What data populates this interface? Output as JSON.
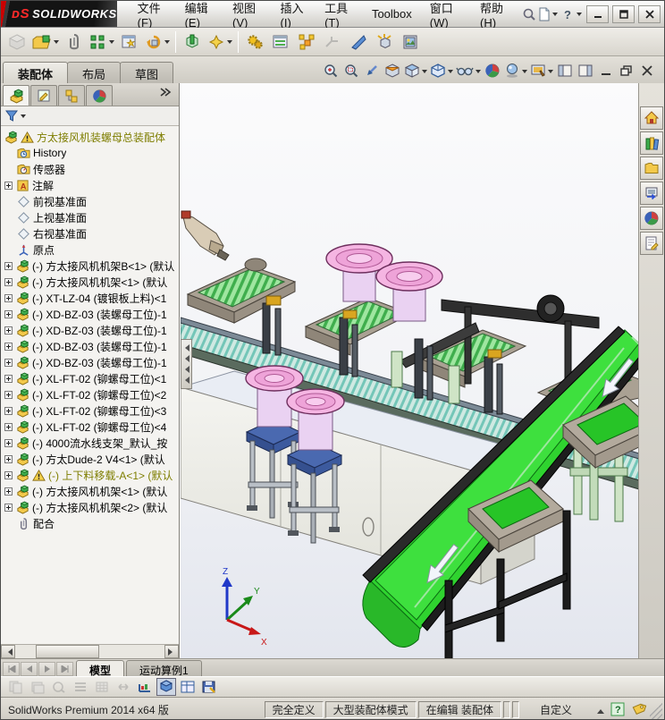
{
  "titlebar": {
    "logo": "SOLIDWORKS",
    "logo_ds": "ᴅS",
    "menus": [
      "文件(F)",
      "编辑(E)",
      "视图(V)",
      "插入(I)",
      "工具(T)",
      "Toolbox",
      "窗口(W)",
      "帮助(H)"
    ]
  },
  "command_tabs": [
    {
      "label": "装配体",
      "active": true
    },
    {
      "label": "布局",
      "active": false
    },
    {
      "label": "草图",
      "active": false
    }
  ],
  "feature_tree": {
    "root": {
      "label": "方太接风机装螺母总装配体"
    },
    "folders": [
      {
        "label": "History"
      },
      {
        "label": "传感器"
      },
      {
        "label": "注解"
      },
      {
        "label": "前视基准面"
      },
      {
        "label": "上视基准面"
      },
      {
        "label": "右视基准面"
      },
      {
        "label": "原点"
      }
    ],
    "components": [
      {
        "label": "(-) 方太接风机机架B<1> (默认"
      },
      {
        "label": "(-) 方太接风机机架<1> (默认"
      },
      {
        "label": "(-) XT-LZ-04 (镀银板上料)<1"
      },
      {
        "label": "(-) XD-BZ-03 (装螺母工位)-1"
      },
      {
        "label": "(-) XD-BZ-03 (装螺母工位)-1"
      },
      {
        "label": "(-) XD-BZ-03 (装螺母工位)-1"
      },
      {
        "label": "(-) XD-BZ-03 (装螺母工位)-1"
      },
      {
        "label": "(-) XL-FT-02 (铆螺母工位)<1"
      },
      {
        "label": "(-) XL-FT-02 (铆螺母工位)<2"
      },
      {
        "label": "(-) XL-FT-02 (铆螺母工位)<3"
      },
      {
        "label": "(-) XL-FT-02 (铆螺母工位)<4"
      },
      {
        "label": "(-) 4000流水线支架_默认_按"
      },
      {
        "label": "(-) 方太Dude-2 V4<1> (默认"
      },
      {
        "label": "(-) 上下料移载-A<1> (默认",
        "warning": true
      },
      {
        "label": "(-) 方太接风机机架<1> (默认"
      },
      {
        "label": "(-) 方太接风机机架<2> (默认"
      }
    ],
    "mates_label": "配合"
  },
  "motion_bar": {
    "tabs": [
      {
        "label": "模型",
        "active": true
      },
      {
        "label": "运动算例1",
        "active": false
      }
    ]
  },
  "statusbar": {
    "left_text": "SolidWorks Premium 2014 x64 版",
    "define_state": "完全定义",
    "assembly_mode": "大型装配体模式",
    "edit_state": "在编辑 装配体",
    "custom_label": "自定义"
  },
  "viewport": {
    "triad": {
      "x": "X",
      "y": "Y",
      "z": "Z"
    }
  },
  "colors": {
    "brand_red": "#d40000",
    "belt_green": "#2fd32f",
    "slat_green": "#3fae4d",
    "bowl_pink": "#f5b5e2",
    "plate_blue": "#4a69b0",
    "warning_olive": "#7e7e00"
  }
}
